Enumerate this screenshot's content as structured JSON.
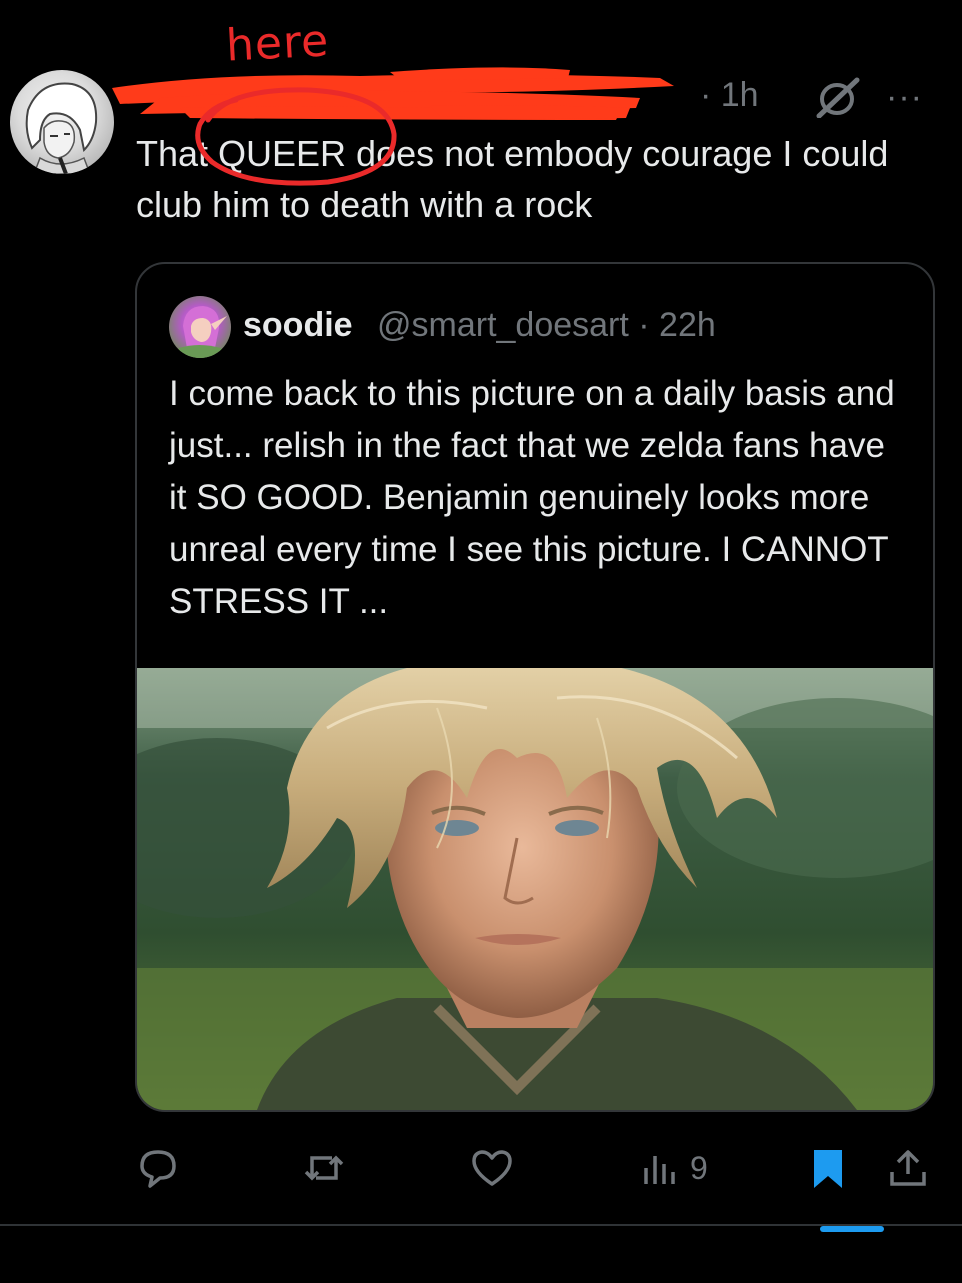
{
  "annotation": {
    "label": "here",
    "color": "#ea2a2a",
    "scribble_color": "#ff3b1a"
  },
  "tweet": {
    "time": "· 1h",
    "text": "That QUEER does not embody courage I could club him to death with a rock",
    "more_label": "···",
    "grok_icon": "grok-slash-icon",
    "avatar_icon": "anime-sketch-avatar"
  },
  "quote": {
    "name": "soodie",
    "handle_time": "@smart_doesart · 22h",
    "text": "I come back to this picture on a daily basis and just... relish in the fact that we zelda fans have it SO GOOD. Benjamin genuinely looks more unreal every time I see this picture. I CANNOT STRESS IT ...",
    "media_alt": "close-up photo of a young man with shaggy blond hair and pointed ears in a green field"
  },
  "actions": {
    "reply_icon": "reply-bubble-icon",
    "repost_icon": "repost-icon",
    "like_icon": "heart-icon",
    "views_icon": "views-chart-icon",
    "views_count": "9",
    "bookmark_icon": "bookmark-icon",
    "share_icon": "share-icon",
    "muted_color": "#71767b",
    "accent_color": "#1d9bf0"
  }
}
